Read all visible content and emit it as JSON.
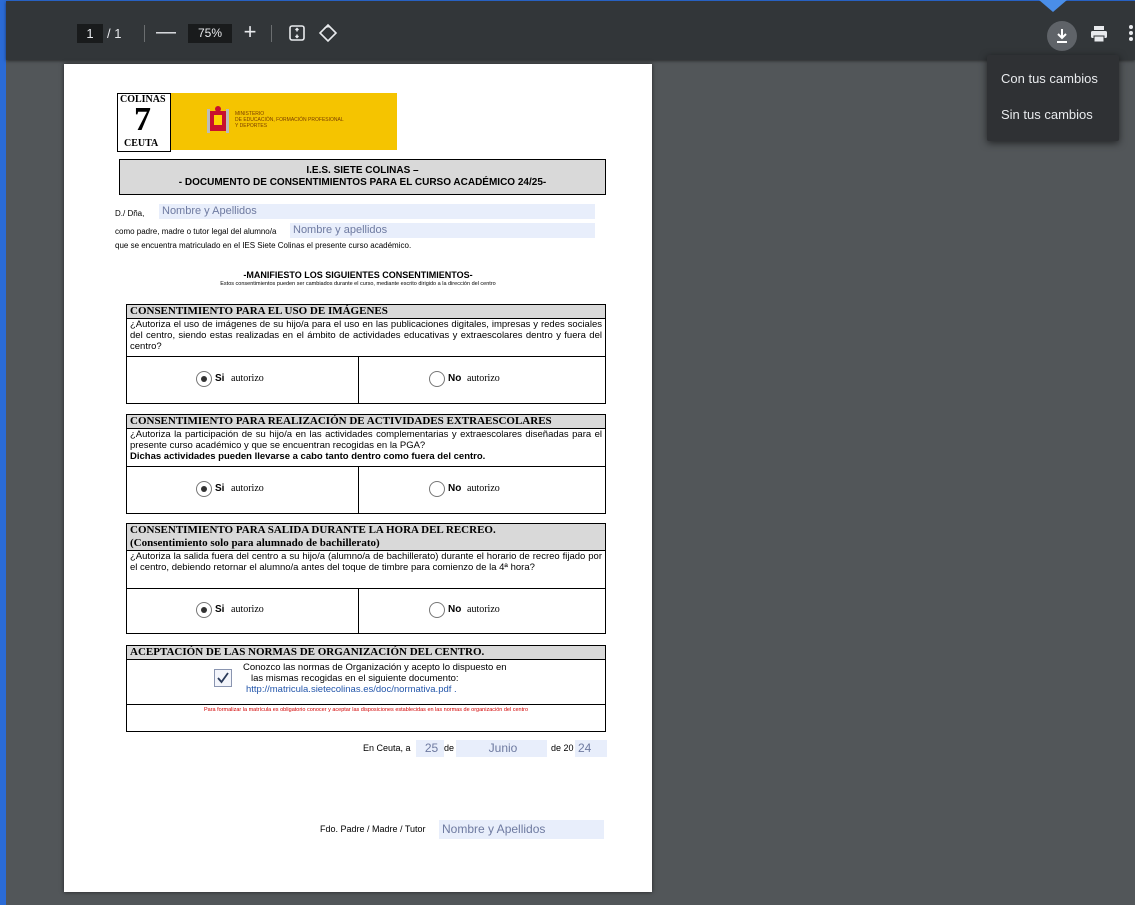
{
  "toolbar": {
    "page_current": "1",
    "page_total": "/ 1",
    "zoom": "75%",
    "zoom_minus": "—",
    "zoom_plus": "+"
  },
  "download_menu": {
    "items": [
      "Con tus cambios",
      "Sin tus cambios"
    ]
  },
  "doc": {
    "logo_top": "COLINAS",
    "logo_bottom": "CEUTA",
    "logo_big": "7",
    "ministry": [
      "MINISTERIO",
      "DE EDUCACIÓN, FORMACIÓN PROFESIONAL",
      "Y DEPORTES"
    ],
    "title1": "I.E.S. SIETE COLINAS –",
    "title2": "- DOCUMENTO DE CONSENTIMIENTOS PARA EL CURSO ACADÉMICO 24/25-",
    "label_name": "D./ Dña,",
    "value_name": "Nombre y Apellidos",
    "label_parent": "como padre, madre o tutor legal del alumno/a",
    "value_student": "Nombre y apellidos",
    "enrolled": "que se encuentra matriculado en el IES Siete Colinas el presente curso académico.",
    "manifest": "-MANIFIESTO LOS SIGUIENTES CONSENTIMIENTOS-",
    "manifest_note": "Estos consentimientos pueden ser cambiados durante el curso, mediante escrito dirigido a la dirección del centro",
    "sections": [
      {
        "head": "CONSENTIMIENTO PARA EL USO DE IMÁGENES",
        "question": "¿Autoriza el uso de imágenes de su hijo/a para el uso en las publicaciones digitales, impresas y redes sociales del centro, siendo estas realizadas en el ámbito de actividades educativas y extraescolares dentro y fuera del centro?"
      },
      {
        "head": "CONSENTIMIENTO PARA REALIZACIÓN DE ACTIVIDADES EXTRAESCOLARES",
        "question": "¿Autoriza la participación de su hijo/a en las actividades complementarias y extraescolares diseñadas para el presente curso académico y que se encuentran recogidas en la PGA?",
        "bold_line": "Dichas actividades pueden llevarse a cabo tanto dentro como fuera del centro."
      },
      {
        "head": "CONSENTIMIENTO PARA SALIDA DURANTE LA HORA DEL RECREO.",
        "head2": "(Consentimiento solo para alumnado de bachillerato)",
        "question": "¿Autoriza la salida fuera del centro a su hijo/a (alumno/a de bachillerato) durante el horario de recreo fijado por el centro, debiendo retornar el alumno/a antes del toque de timbre para comienzo de la 4ª hora?"
      }
    ],
    "opt_si": "Si",
    "opt_no": "No",
    "opt_rest": "autorizo",
    "norms_head": "ACEPTACIÓN DE LAS NORMAS DE ORGANIZACIÓN DEL CENTRO.",
    "norms_line1": "Conozco las normas de Organización y acepto lo dispuesto en",
    "norms_line2": "las mismas recogidas en el siguiente documento:",
    "norms_link": "http://matricula.sietecolinas.es/doc/normativa.pdf .",
    "norms_warning": "Para formalizar la matrícula es obligatorio conocer y aceptar las disposiciones establecidas en las normas de organización del centro",
    "date_label": "En Ceuta, a",
    "date_day": "25",
    "date_de": "de",
    "date_month": "Junio",
    "date_de20": "de 20",
    "date_year": "24",
    "sign_label": "Fdo. Padre / Madre / Tutor",
    "sign_value": "Nombre y Apellidos"
  }
}
